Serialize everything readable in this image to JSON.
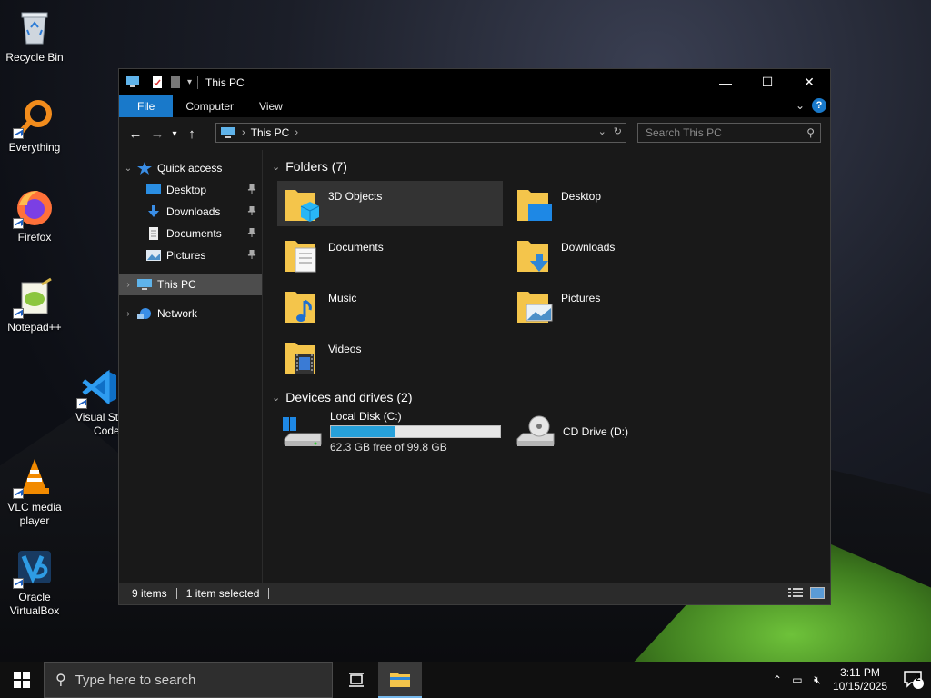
{
  "desktop": {
    "icons": [
      {
        "label": "Recycle Bin",
        "icon": "recycle-bin-icon"
      },
      {
        "label": "Everything",
        "icon": "everything-search-icon"
      },
      {
        "label": "Firefox",
        "icon": "firefox-icon"
      },
      {
        "label": "Notepad++",
        "icon": "notepad-plus-plus-icon"
      },
      {
        "label": "Visual Studio Code",
        "label_line1": "Visual Stu",
        "label_line2": "Code",
        "icon": "vscode-icon"
      },
      {
        "label_line1": "VLC media",
        "label_line2": "player",
        "icon": "vlc-icon"
      },
      {
        "label_line1": "Oracle",
        "label_line2": "VirtualBox",
        "icon": "virtualbox-icon"
      }
    ]
  },
  "window": {
    "title": "This PC",
    "controls": {
      "minimize": "—",
      "maximize": "☐",
      "close": "✕"
    },
    "ribbon_tabs": [
      "File",
      "Computer",
      "View"
    ],
    "address": {
      "crumb": "This PC"
    },
    "search": {
      "placeholder": "Search This PC"
    }
  },
  "navpane": {
    "quick_access": "Quick access",
    "pinned": [
      {
        "label": "Desktop",
        "icon": "desktop-icon"
      },
      {
        "label": "Downloads",
        "icon": "downloads-icon"
      },
      {
        "label": "Documents",
        "icon": "documents-icon"
      },
      {
        "label": "Pictures",
        "icon": "pictures-icon"
      }
    ],
    "this_pc": "This PC",
    "network": "Network"
  },
  "content": {
    "folders_header": "Folders (7)",
    "folders": [
      {
        "name": "3D Objects",
        "icon": "3d-objects-folder-icon"
      },
      {
        "name": "Desktop",
        "icon": "desktop-folder-icon"
      },
      {
        "name": "Documents",
        "icon": "documents-folder-icon"
      },
      {
        "name": "Downloads",
        "icon": "downloads-folder-icon"
      },
      {
        "name": "Music",
        "icon": "music-folder-icon"
      },
      {
        "name": "Pictures",
        "icon": "pictures-folder-icon"
      },
      {
        "name": "Videos",
        "icon": "videos-folder-icon"
      }
    ],
    "devices_header": "Devices and drives (2)",
    "drives": [
      {
        "name": "Local Disk (C:)",
        "free_text": "62.3 GB free of 99.8 GB",
        "used_fraction": 0.376
      },
      {
        "name": "CD Drive (D:)"
      }
    ]
  },
  "statusbar": {
    "items": "9 items",
    "selected": "1 item selected"
  },
  "taskbar": {
    "search_placeholder": "Type here to search",
    "time": "3:11 PM",
    "date": "10/15/2025",
    "notification_count": "2"
  },
  "colors": {
    "accent": "#1979ca",
    "drive_fill": "#26a0da",
    "folder_yellow": "#f4c54b"
  }
}
